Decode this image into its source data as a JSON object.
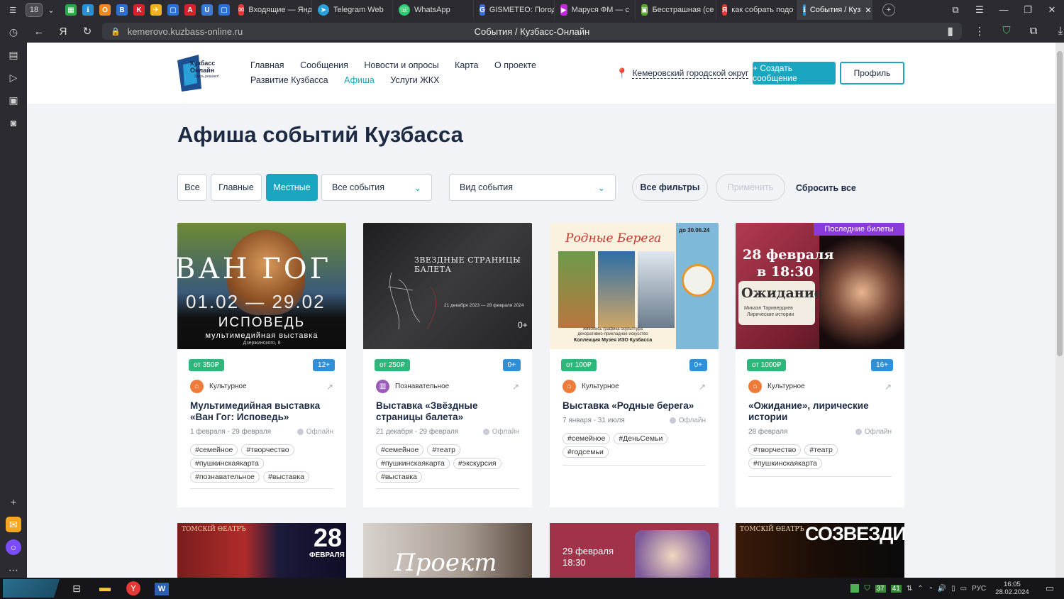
{
  "browser": {
    "tab_count": "18",
    "tabs": [
      {
        "title": "Входящие — Янд",
        "icon": "mail-icon"
      },
      {
        "title": "Telegram Web",
        "icon": "telegram-icon"
      },
      {
        "title": "WhatsApp",
        "icon": "whatsapp-icon"
      },
      {
        "title": "GISMETEO: Погод",
        "icon": "gismeteo-icon"
      },
      {
        "title": "Маруся ФМ — с",
        "icon": "radio-icon"
      },
      {
        "title": "Бесстрашная (се",
        "icon": "video-icon"
      },
      {
        "title": "как собрать подо",
        "icon": "yandex-icon"
      },
      {
        "title": "События / Куз",
        "icon": "kuzbass-icon"
      }
    ],
    "url": "kemerovo.kuzbass-online.ru",
    "page_title": "События / Кузбасс-Онлайн"
  },
  "header": {
    "logo_text_1": "Кузбасс",
    "logo_text_2": "Онлайн",
    "logo_sub": "Здесь решают!",
    "menu_row1": [
      "Главная",
      "Сообщения",
      "Новости и опросы",
      "Карта",
      "О проекте"
    ],
    "menu_row2": [
      "Развитие Кузбасса",
      "Афиша",
      "Услуги ЖКХ"
    ],
    "active_menu": "Афиша",
    "region": "Кемеровский городской округ",
    "create_button": "+ Создать сообщение",
    "profile_button": "Профиль"
  },
  "page": {
    "title": "Афиша событий Кузбасса"
  },
  "filters": {
    "chips": [
      "Все",
      "Главные",
      "Местные"
    ],
    "active_chip": "Местные",
    "events_select": "Все события",
    "type_select": "Вид события",
    "all_filters": "Все фильтры",
    "apply": "Применить",
    "reset": "Сбросить все"
  },
  "cards": [
    {
      "price": "от 350₽",
      "age": "12+",
      "category": "Культурное",
      "title": "Мультимедийная выставка «Ван Гог: Исповедь»",
      "dates": "1 февраля - 29 февраля",
      "mode": "Офлайн",
      "tags": [
        "#семейное",
        "#творчество",
        "#пушкинскаякарта",
        "#познавательное",
        "#выставка"
      ],
      "poster": {
        "head": "ВАН ГОГ",
        "dates": "01.02 — 29.02",
        "sub": "ИСПОВЕДЬ",
        "line": "мультимедийная выставка",
        "addr": "Дзержинского, 8"
      }
    },
    {
      "price": "от 250₽",
      "age": "0+",
      "category": "Познавательное",
      "title": "Выставка «Звёздные страницы балета»",
      "dates": "21 декабря - 29 февраля",
      "mode": "Офлайн",
      "tags": [
        "#семейное",
        "#театр",
        "#пушкинскаякарта",
        "#экскурсия",
        "#выставка"
      ],
      "poster": {
        "head": "ЗВЕЗДНЫЕ СТРАНИЦЫ БАЛЕТА",
        "dates": "21 декабря 2023 — 29 февраля 2024",
        "age": "0+"
      }
    },
    {
      "price": "от 100₽",
      "age": "0+",
      "category": "Культурное",
      "title": "Выставка «Родные берега»",
      "dates": "7 января - 31 июля",
      "mode": "Офлайн",
      "tags": [
        "#семейное",
        "#ДеньСемьи",
        "#годсемьи"
      ],
      "poster": {
        "head": "Родные Берега",
        "until": "до 30.06.24",
        "line1": "живопись  графика  скульптура",
        "line2": "декоративно-прикладное искусство",
        "line3": "Коллекция Музея ИЗО Кузбасса"
      }
    },
    {
      "price": "от 1000₽",
      "age": "16+",
      "category": "Культурное",
      "title": "«Ожидание», лирические истории",
      "dates": "28 февраля",
      "mode": "Офлайн",
      "badge": "Последние билеты",
      "tags": [
        "#творчество",
        "#театр",
        "#пушкинскаякарта"
      ],
      "poster": {
        "date": "28 февраля",
        "time": "в 18:30",
        "head": "Ожидание",
        "line1": "Микаэл Таривердиев",
        "line2": "Лирические истории"
      }
    }
  ],
  "cards_row2": [
    {
      "poster_head": "ТОМСКІЙ ѲЕАТРЪ",
      "day": "28",
      "month": "ФЕВРАЛЯ"
    },
    {
      "poster_head": "Проект"
    },
    {
      "poster_head": "29 февраля",
      "time": "18:30"
    },
    {
      "poster_head": "ТОМСКІЙ ѲЕАТРЪ",
      "title": "СОЗВЕЗДИЯ"
    }
  ],
  "taskbar": {
    "lang": "РУС",
    "time": "16:05",
    "date": "28.02.2024",
    "tray_num1": "37",
    "tray_num2": "41"
  },
  "colors": {
    "accent": "#1aa6c0",
    "price_badge": "#2fb67a",
    "age_badge": "#2f8fd7",
    "dark_text": "#1d2a44"
  }
}
